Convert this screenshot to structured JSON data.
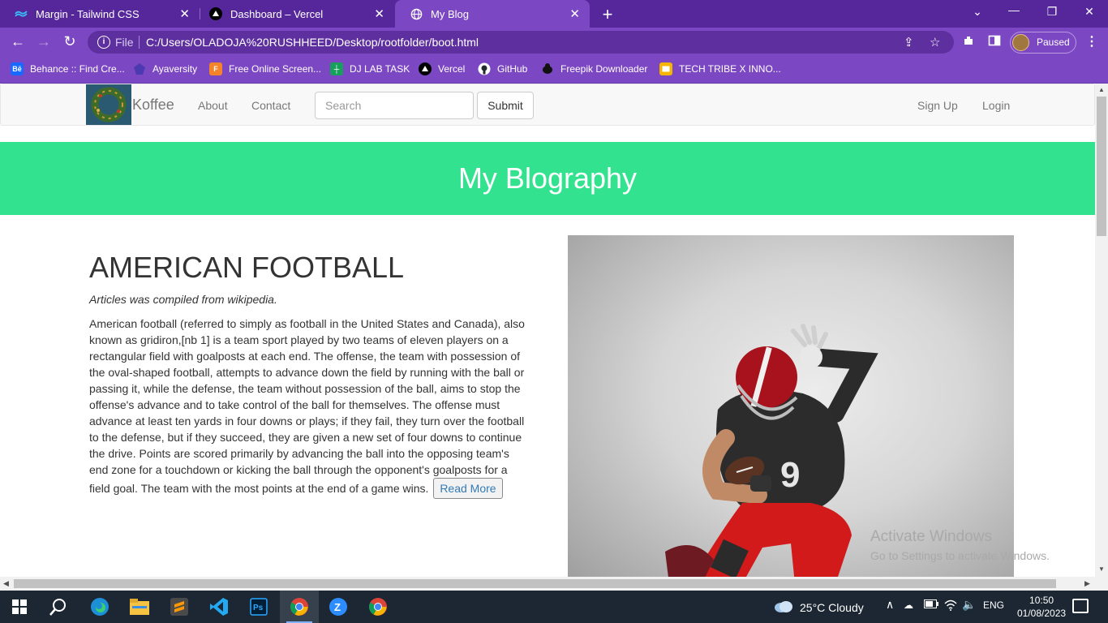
{
  "browser": {
    "tabs": [
      {
        "title": "Margin - Tailwind CSS",
        "icon": "tailwind-icon"
      },
      {
        "title": "Dashboard – Vercel",
        "icon": "vercel-icon"
      },
      {
        "title": "My Blog",
        "icon": "globe-icon"
      }
    ],
    "active_tab": 2,
    "url_scheme_label": "File",
    "url": "C:/Users/OLADOJA%20RUSHHEED/Desktop/rootfolder/boot.html",
    "profile_label": "Paused",
    "bookmarks": [
      {
        "label": "Behance :: Find Cre...",
        "icon": "behance-icon"
      },
      {
        "label": "Ayaversity",
        "icon": "ayaversity-icon"
      },
      {
        "label": "Free Online Screen...",
        "icon": "screen-recorder-icon"
      },
      {
        "label": "DJ LAB TASK",
        "icon": "sheets-icon"
      },
      {
        "label": "Vercel",
        "icon": "vercel-icon"
      },
      {
        "label": "GitHub",
        "icon": "github-icon"
      },
      {
        "label": "Freepik Downloader",
        "icon": "freepik-icon"
      },
      {
        "label": "TECH TRIBE X INNO...",
        "icon": "slides-icon"
      }
    ]
  },
  "page": {
    "brand": "Koffee",
    "nav": {
      "about": "About",
      "contact": "Contact",
      "signup": "Sign Up",
      "login": "Login"
    },
    "search": {
      "placeholder": "Search",
      "submit_label": "Submit"
    },
    "hero_title": "My Blography",
    "article": {
      "title": "AMERICAN FOOTBALL",
      "subtitle": "Articles was compiled from wikipedia.",
      "body": "American football (referred to simply as football in the United States and Canada), also known as gridiron,[nb 1] is a team sport played by two teams of eleven players on a rectangular field with goalposts at each end. The offense, the team with possession of the oval-shaped football, attempts to advance down the field by running with the ball or passing it, while the defense, the team without possession of the ball, aims to stop the offense's advance and to take control of the ball for themselves. The offense must advance at least ten yards in four downs or plays; if they fail, they turn over the football to the defense, but if they succeed, they are given a new set of four downs to continue the drive. Points are scored primarily by advancing the ball into the opposing team's end zone for a touchdown or kicking the ball through the opponent's goalposts for a field goal. The team with the most points at the end of a game wins.",
      "read_more": "Read More",
      "jersey_number": "9"
    }
  },
  "watermark": {
    "line1": "Activate Windows",
    "line2": "Go to Settings to activate Windows."
  },
  "taskbar": {
    "weather": "25°C  Cloudy",
    "language": "ENG",
    "time": "10:50",
    "date": "01/08/2023"
  }
}
